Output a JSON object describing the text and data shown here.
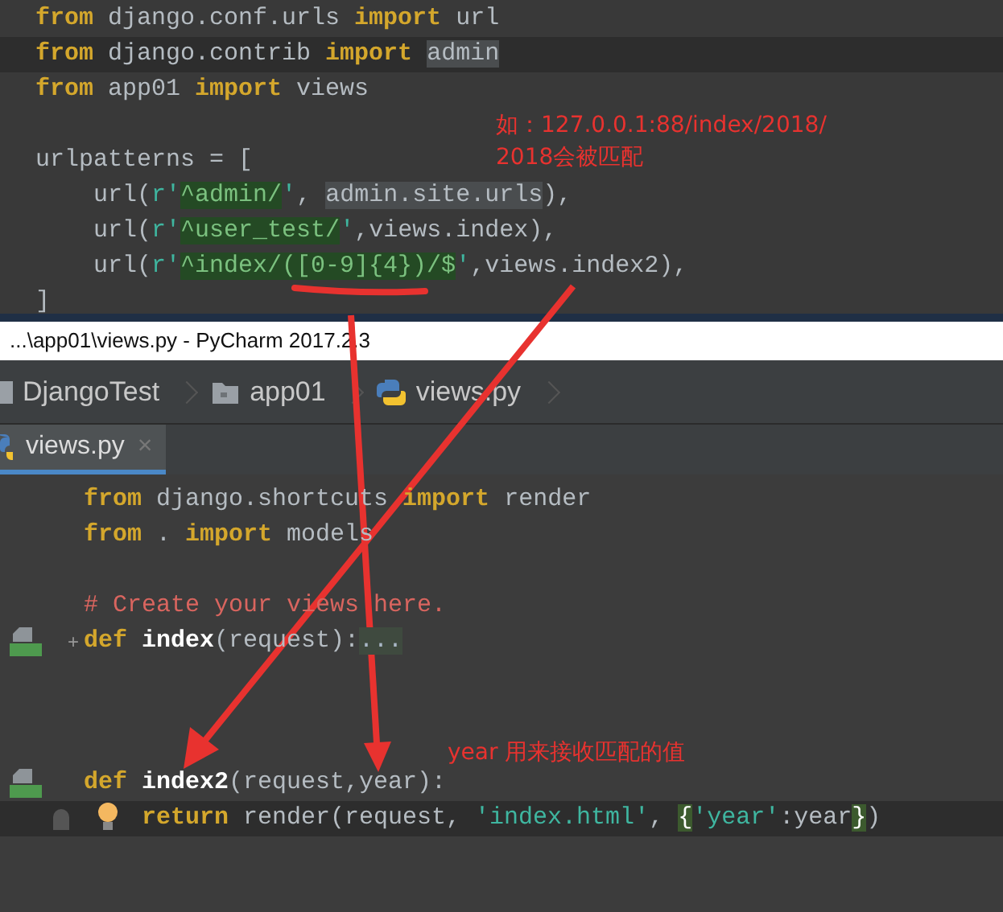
{
  "top_editor": {
    "lines": [
      {
        "current": false,
        "tokens": [
          {
            "kind": "kw",
            "text": "from"
          },
          {
            "kind": "plain",
            "text": " django.conf.urls "
          },
          {
            "kind": "kw",
            "text": "import"
          },
          {
            "kind": "plain",
            "text": " url"
          }
        ]
      },
      {
        "current": true,
        "tokens": [
          {
            "kind": "kw",
            "text": "from"
          },
          {
            "kind": "plain",
            "text": " django.contrib "
          },
          {
            "kind": "kw",
            "text": "import "
          },
          {
            "kind": "ref",
            "text": "admin"
          }
        ]
      },
      {
        "current": false,
        "tokens": [
          {
            "kind": "kw",
            "text": "from"
          },
          {
            "kind": "plain",
            "text": " app01 "
          },
          {
            "kind": "kw",
            "text": "import"
          },
          {
            "kind": "plain",
            "text": " views"
          }
        ]
      },
      {
        "kind": "blank"
      },
      {
        "current": false,
        "tokens": [
          {
            "kind": "plain",
            "text": "urlpatterns = ["
          }
        ]
      },
      {
        "current": false,
        "tokens": [
          {
            "kind": "plain",
            "text": "    url("
          },
          {
            "kind": "str",
            "text": "r'"
          },
          {
            "kind": "regex",
            "text": "^admin/"
          },
          {
            "kind": "str",
            "text": "'"
          },
          {
            "kind": "plain",
            "text": ", "
          },
          {
            "kind": "ref",
            "text": "admin.site.urls"
          },
          {
            "kind": "plain",
            "text": "),"
          }
        ]
      },
      {
        "current": false,
        "tokens": [
          {
            "kind": "plain",
            "text": "    url("
          },
          {
            "kind": "str",
            "text": "r'"
          },
          {
            "kind": "regex",
            "text": "^user_test/"
          },
          {
            "kind": "str",
            "text": "'"
          },
          {
            "kind": "plain",
            "text": ",views.index),"
          }
        ]
      },
      {
        "current": false,
        "tokens": [
          {
            "kind": "plain",
            "text": "    url("
          },
          {
            "kind": "str",
            "text": "r'"
          },
          {
            "kind": "regex",
            "text": "^index/([0-9]{4})/$"
          },
          {
            "kind": "str",
            "text": "'"
          },
          {
            "kind": "plain",
            "text": ",views.index2),"
          }
        ]
      },
      {
        "current": false,
        "tokens": [
          {
            "kind": "plain",
            "text": "]"
          }
        ]
      }
    ]
  },
  "window": {
    "title": "...\\app01\\views.py - PyCharm 2017.2.3"
  },
  "breadcrumbs": [
    {
      "kind": "project",
      "label": "DjangoTest"
    },
    {
      "kind": "folder",
      "label": "app01"
    },
    {
      "kind": "python",
      "label": "views.py"
    }
  ],
  "tabs": [
    {
      "label": "views.py",
      "selected": true,
      "close": "×"
    }
  ],
  "editor": {
    "lines": [
      {
        "current": false,
        "tokens": [
          {
            "kind": "kw",
            "text": "from"
          },
          {
            "kind": "plain",
            "text": " django.shortcuts "
          },
          {
            "kind": "kw",
            "text": "import"
          },
          {
            "kind": "plain",
            "text": " render"
          }
        ]
      },
      {
        "current": false,
        "tokens": [
          {
            "kind": "kw",
            "text": "from"
          },
          {
            "kind": "plain",
            "text": " . "
          },
          {
            "kind": "kw",
            "text": "import"
          },
          {
            "kind": "plain",
            "text": " models"
          }
        ]
      },
      {
        "kind": "blank"
      },
      {
        "current": false,
        "tokens": [
          {
            "kind": "comment",
            "text": "# Create your views here."
          }
        ]
      },
      {
        "current": false,
        "gutter": {
          "kind": "override"
        },
        "fold": "+",
        "tokens": [
          {
            "kind": "kw",
            "text": "def "
          },
          {
            "kind": "fn",
            "text": "index"
          },
          {
            "kind": "plain",
            "text": "(request):"
          },
          {
            "kind": "folded",
            "text": "..."
          }
        ]
      },
      {
        "kind": "blank"
      },
      {
        "kind": "blank"
      },
      {
        "kind": "blank"
      },
      {
        "current": false,
        "gutter": {
          "kind": "override"
        },
        "tokens": [
          {
            "kind": "kw",
            "text": "def "
          },
          {
            "kind": "fn",
            "text": "index2"
          },
          {
            "kind": "plain",
            "text": "(request,year):"
          }
        ]
      },
      {
        "current": true,
        "kind": "body",
        "gutter": {
          "kind": "bulb"
        },
        "tokens": [
          {
            "kind": "kw",
            "text": "return"
          },
          {
            "kind": "plain",
            "text": " render(request, "
          },
          {
            "kind": "str",
            "text": "'index.html'"
          },
          {
            "kind": "plain",
            "text": ", "
          },
          {
            "kind": "brace",
            "text": "{"
          },
          {
            "kind": "str",
            "text": "'year'"
          },
          {
            "kind": "plain",
            "text": ":year"
          },
          {
            "kind": "brace",
            "text": "}"
          },
          {
            "kind": "plain",
            "text": ")"
          }
        ]
      }
    ]
  },
  "annotations": [
    {
      "lines": [
        "如：127.0.0.1:88/index/2018/",
        "2018会被匹配"
      ]
    },
    {
      "lines": [
        "year 用来接收匹配的值"
      ]
    }
  ]
}
